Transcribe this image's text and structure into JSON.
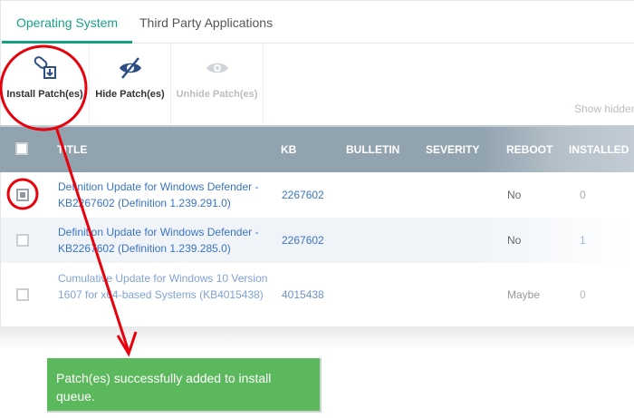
{
  "tabs": [
    {
      "label": "Operating System",
      "active": true
    },
    {
      "label": "Third Party Applications",
      "active": false
    }
  ],
  "toolbar": {
    "install": "Install Patch(es)",
    "hide": "Hide Patch(es)",
    "unhide": "Unhide Patch(es)",
    "show_hidden": "Show hidden"
  },
  "table": {
    "headers": {
      "title": "TITLE",
      "kb": "KB",
      "bulletin": "BULLETIN",
      "severity": "SEVERITY",
      "reboot": "REBOOT",
      "installed": "INSTALLED"
    },
    "rows": [
      {
        "title": "Definition Update for Windows Defender - KB2267602 (Definition 1.239.291.0)",
        "kb": "2267602",
        "reboot": "No",
        "installed": "0",
        "checked": true
      },
      {
        "title": "Definition Update for Windows Defender - KB2267602 (Definition 1.239.285.0)",
        "kb": "2267602",
        "reboot": "No",
        "installed": "1",
        "checked": false
      },
      {
        "title": "Cumulative Update for Windows 10 Version 1607 for x64-based Systems (KB4015438)",
        "kb": "4015438",
        "reboot": "Maybe",
        "installed": "0",
        "checked": false
      }
    ]
  },
  "toast": {
    "message": "Patch(es) successfully added to install queue."
  },
  "colors": {
    "accent": "#18a085",
    "header": "#92a3b0",
    "toast": "#5cb85c",
    "annotation": "#e8000b"
  }
}
